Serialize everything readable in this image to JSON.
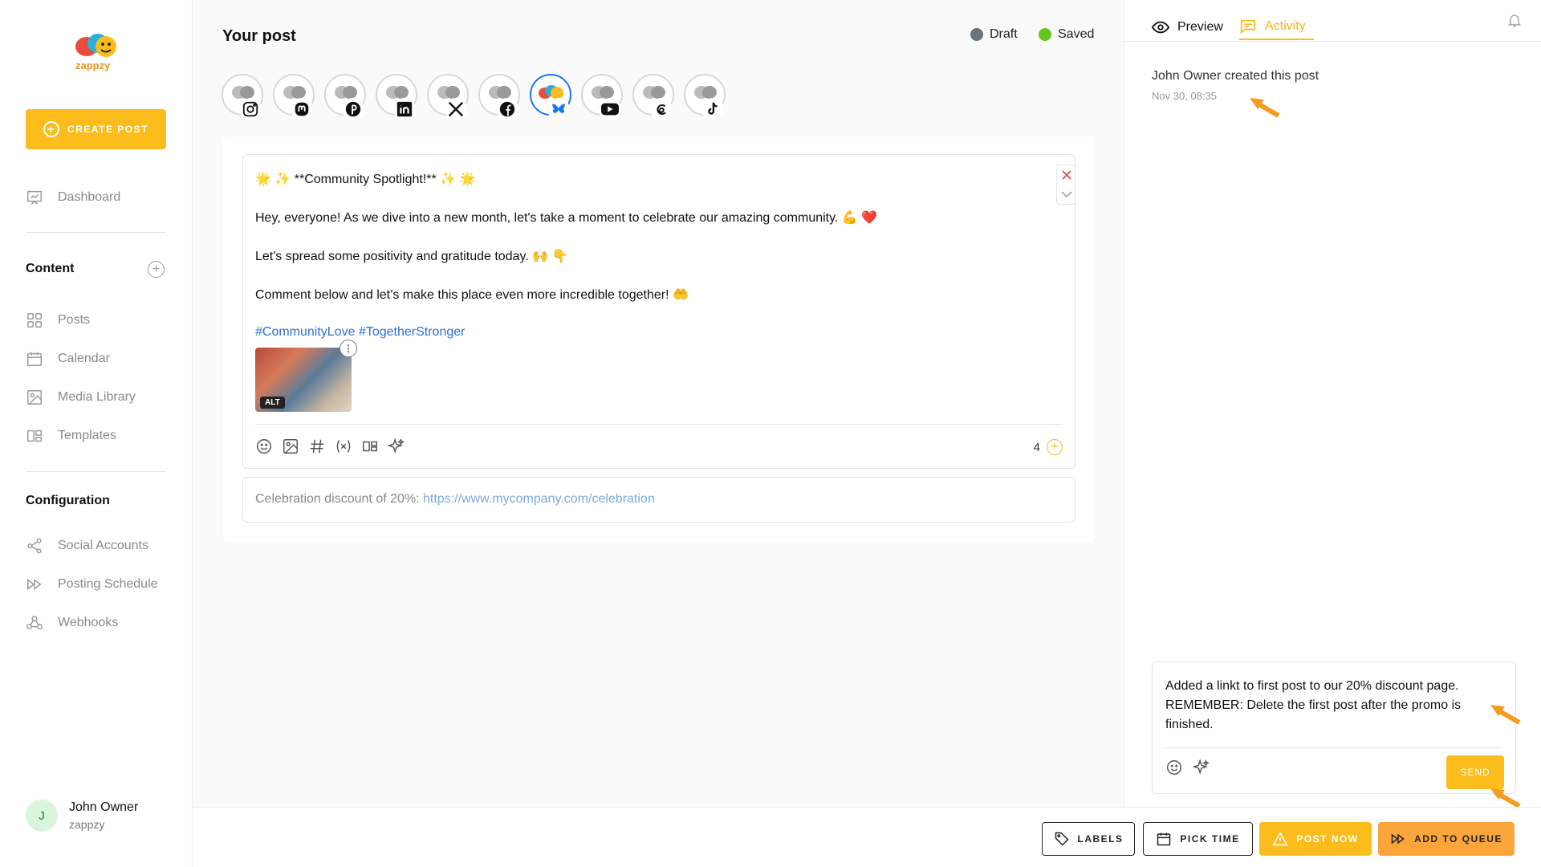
{
  "sidebar": {
    "logo_text": "zappzy",
    "create_label": "CREATE POST",
    "dashboard": "Dashboard",
    "content_title": "Content",
    "items": [
      "Posts",
      "Calendar",
      "Media Library",
      "Templates"
    ],
    "config_title": "Configuration",
    "config_items": [
      "Social Accounts",
      "Posting Schedule",
      "Webhooks"
    ],
    "user": {
      "initial": "J",
      "name": "John Owner",
      "org": "zappzy"
    }
  },
  "main": {
    "title": "Your post",
    "status_draft": "Draft",
    "status_saved": "Saved",
    "draft_color": "#6b7280",
    "saved_color": "#66c41f",
    "accounts": [
      "instagram",
      "mastodon",
      "pinterest",
      "linkedin",
      "x",
      "facebook",
      "bluesky",
      "youtube",
      "threads",
      "tiktok"
    ],
    "selected_account": "bluesky",
    "post": {
      "line1": "🌟 ✨ **Community Spotlight!** ✨ 🌟",
      "line2": "Hey, everyone! As we dive into a new month, let's take a moment to celebrate our amazing community. 💪 ❤️",
      "line3": "Let's spread some positivity and gratitude today. 🙌 👇",
      "line4": "Comment below and let’s make this place even more incredible together! 🤲",
      "hashtags": "#CommunityLove #TogetherStronger",
      "alt_label": "ALT",
      "thread_count": "4"
    },
    "first_comment": {
      "prefix": "Celebration discount of 20%: ",
      "link": "https://www.mycompany.com/celebration"
    }
  },
  "right": {
    "tab_preview": "Preview",
    "tab_activity": "Activity",
    "activity_text": "John Owner created this post",
    "activity_time": "Nov 30, 08:35",
    "compose_text": "Added a linkt to first post to our 20% discount page. REMEMBER: Delete the first post after the promo is finished.",
    "send_label": "SEND",
    "accent": "#fcbd1c",
    "arrow_color": "#f39c1f"
  },
  "footer": {
    "labels": "LABELS",
    "pick_time": "PICK TIME",
    "post_now": "POST NOW",
    "add_queue": "ADD TO QUEUE"
  }
}
